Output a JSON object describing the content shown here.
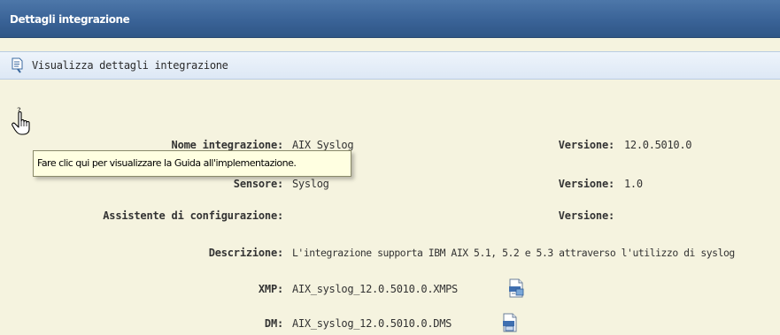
{
  "header": {
    "title": "Dettagli integrazione"
  },
  "toolbar": {
    "label": "Visualizza dettagli integrazione",
    "icon": "document-view-icon"
  },
  "help": {
    "icon": "hand-pointer-help-icon",
    "tooltip": "Fare clic qui per visualizzare la Guida all'implementazione."
  },
  "fields": {
    "integration_name_label": "Nome integrazione:",
    "integration_name_value": "AIX_Syslog",
    "integration_version_label": "Versione:",
    "integration_version_value": "12.0.5010.0",
    "sensor_label": "Sensore:",
    "sensor_value": "Syslog",
    "sensor_version_label": "Versione:",
    "sensor_version_value": "1.0",
    "wizard_label": "Assistente di configurazione:",
    "wizard_value": "",
    "wizard_version_label": "Versione:",
    "wizard_version_value": "",
    "description_label": "Descrizione:",
    "description_value": "L'integrazione supporta IBM AIX 5.1, 5.2 e 5.3 attraverso l'utilizzo di syslog",
    "xmp_label": "XMP:",
    "xmp_value": "AIX_syslog_12.0.5010.0.XMPS",
    "dm_label": "DM:",
    "dm_value": "AIX_syslog_12.0.5010.0.DMS"
  },
  "colors": {
    "header": "#3a6397",
    "toolbar": "#dde8f5",
    "background": "#f5f3df",
    "tooltip": "#ffffe1"
  }
}
